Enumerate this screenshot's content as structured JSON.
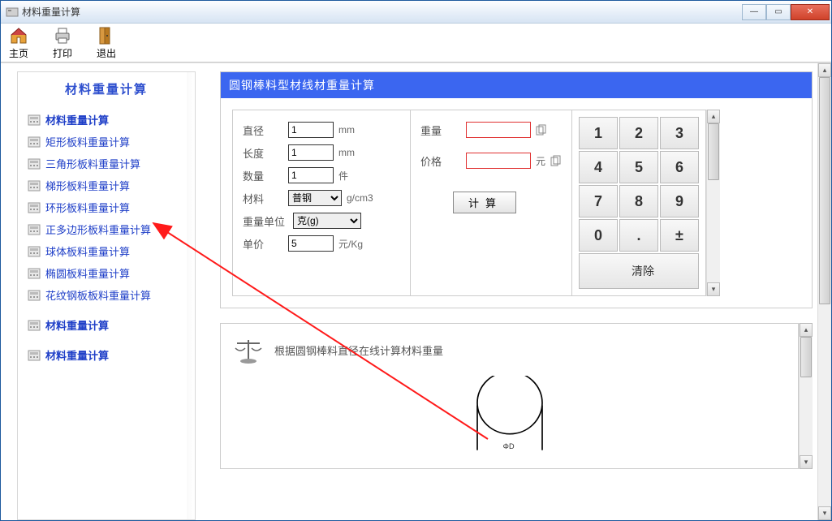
{
  "window": {
    "title": "材料重量计算"
  },
  "toolbar": {
    "home": "主页",
    "print": "打印",
    "exit": "退出"
  },
  "sidebar": {
    "title": "材料重量计算",
    "groups": [
      {
        "items": [
          {
            "label": "材料重量计算",
            "bold": true
          },
          {
            "label": "矩形板料重量计算"
          },
          {
            "label": "三角形板料重量计算"
          },
          {
            "label": "梯形板料重量计算"
          },
          {
            "label": "环形板料重量计算"
          },
          {
            "label": "正多边形板料重量计算"
          },
          {
            "label": "球体板料重量计算"
          },
          {
            "label": "椭圆板料重量计算"
          },
          {
            "label": "花纹钢板板料重量计算"
          }
        ]
      },
      {
        "items": [
          {
            "label": "材料重量计算",
            "bold": true
          }
        ]
      },
      {
        "items": [
          {
            "label": "材料重量计算",
            "bold": true
          }
        ]
      }
    ]
  },
  "panel": {
    "title": "圆钢棒料型材线材重量计算",
    "form": {
      "diameter_label": "直径",
      "diameter_value": "1",
      "diameter_unit": "mm",
      "length_label": "长度",
      "length_value": "1",
      "length_unit": "mm",
      "qty_label": "数量",
      "qty_value": "1",
      "qty_unit": "件",
      "material_label": "材料",
      "material_value": "普钢",
      "material_unit": "g/cm3",
      "weight_unit_label": "重量单位",
      "weight_unit_value": "克(g)",
      "price_label": "单价",
      "price_value": "5",
      "price_unit": "元/Kg"
    },
    "result": {
      "weight_label": "重量",
      "weight_value": "",
      "price_label": "价格",
      "price_value": "",
      "price_unit": "元",
      "calc_button": "计算"
    },
    "keypad": {
      "k1": "1",
      "k2": "2",
      "k3": "3",
      "k4": "4",
      "k5": "5",
      "k6": "6",
      "k7": "7",
      "k8": "8",
      "k9": "9",
      "k0": "0",
      "kdot": ".",
      "kpm": "±",
      "clear": "清除"
    }
  },
  "desc": {
    "text": "根据圆钢棒料直径在线计算材料重量"
  }
}
